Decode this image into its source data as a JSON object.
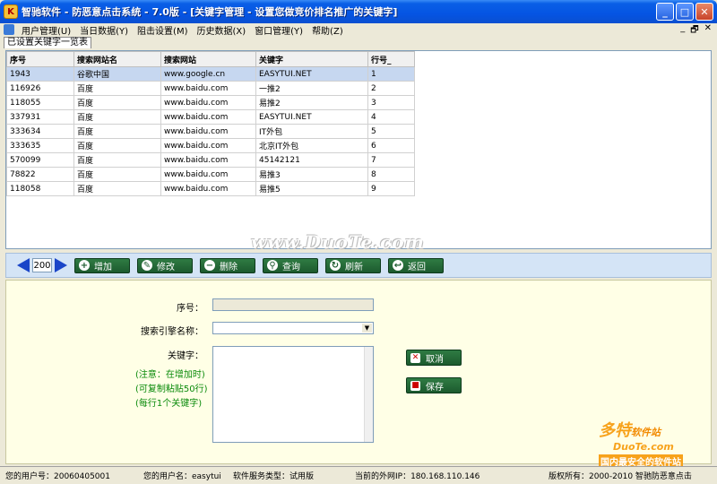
{
  "window": {
    "title": "智驰软件 - 防恶意点击系统 - 7.0版 - [关键字管理 - 设置您做竞价排名推广的关键字]",
    "buttons": [
      "_",
      "□",
      "✕"
    ]
  },
  "menu": {
    "items": [
      "用户管理(U)",
      "当日数据(Y)",
      "阻击设置(M)",
      "历史数据(X)",
      "窗口管理(Y)",
      "帮助(Z)"
    ],
    "mdi_buttons": [
      "_",
      "🗗",
      "✕"
    ]
  },
  "tab": {
    "label": "已设置关键字一览表"
  },
  "table": {
    "columns": [
      "序号",
      "搜索网站名",
      "搜索网站",
      "关键字",
      "行号_"
    ],
    "rows": [
      [
        "1943",
        "谷歌中国",
        "www.google.cn",
        "EASYTUI.NET",
        "1"
      ],
      [
        "116926",
        "百度",
        "www.baidu.com",
        "一推2",
        "2"
      ],
      [
        "118055",
        "百度",
        "www.baidu.com",
        "易推2",
        "3"
      ],
      [
        "337931",
        "百度",
        "www.baidu.com",
        "EASYTUI.NET",
        "4"
      ],
      [
        "333634",
        "百度",
        "www.baidu.com",
        "IT外包",
        "5"
      ],
      [
        "333635",
        "百度",
        "www.baidu.com",
        "北京IT外包",
        "6"
      ],
      [
        "570099",
        "百度",
        "www.baidu.com",
        "45142121",
        "7"
      ],
      [
        "78822",
        "百度",
        "www.baidu.com",
        "易推3",
        "8"
      ],
      [
        "118058",
        "百度",
        "www.baidu.com",
        "易推5",
        "9"
      ]
    ],
    "selected_row": 0
  },
  "watermark": "www.DuoTe.com",
  "toolbar": {
    "page": "200",
    "buttons": [
      {
        "label": "增加",
        "icon": "add-icon"
      },
      {
        "label": "修改",
        "icon": "edit-icon"
      },
      {
        "label": "删除",
        "icon": "delete-icon"
      },
      {
        "label": "查询",
        "icon": "search-icon"
      },
      {
        "label": "刷新",
        "icon": "refresh-icon"
      },
      {
        "label": "返回",
        "icon": "back-icon"
      }
    ]
  },
  "form": {
    "id_label": "序号：",
    "engine_label": "搜索引擎名称：",
    "keyword_label": "关键字：",
    "notes": [
      "(注意：在增加时)",
      "(可复制粘贴50行)",
      "(每行1个关键字)"
    ],
    "cancel_label": "取消",
    "save_label": "保存"
  },
  "logo": {
    "name": "多特",
    "suffix": "软件站",
    "url": "DuoTe.com",
    "slogan": "国内最安全的软件站"
  },
  "status": {
    "user_id": "您的用户号：20060405001",
    "user_name": "您的用户名：easytui",
    "service_type": "软件服务类型：试用版",
    "ip": "当前的外网IP：180.168.110.146",
    "copyright": "版权所有：2000-2010 智驰防恶意点击"
  }
}
